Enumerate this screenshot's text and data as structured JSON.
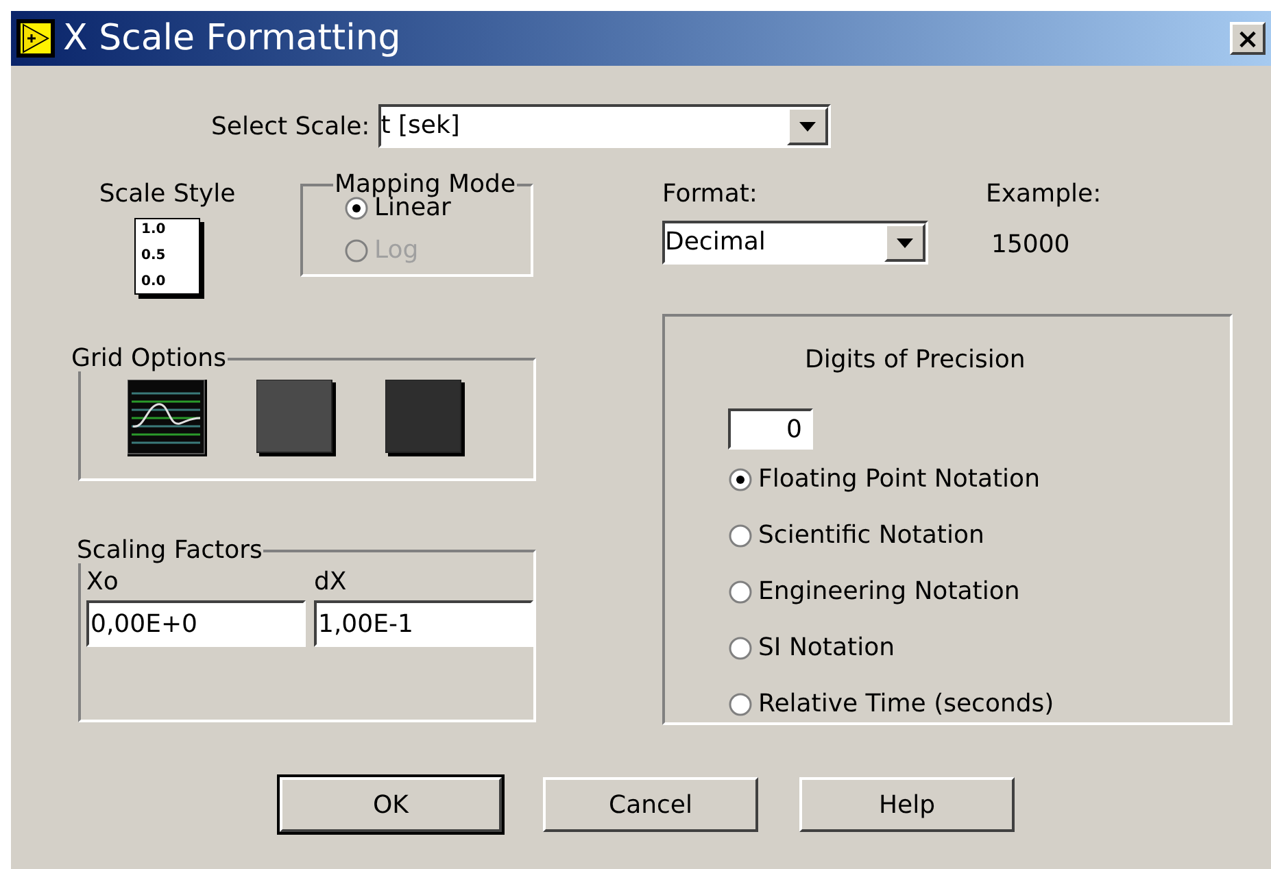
{
  "window": {
    "title": "X Scale Formatting",
    "close": "×"
  },
  "select_scale": {
    "label": "Select Scale:",
    "value": "t [sek]"
  },
  "scale_style": {
    "label": "Scale Style",
    "tick_labels": [
      "1.0",
      "0.5",
      "0.0"
    ]
  },
  "mapping_mode": {
    "title": "Mapping Mode",
    "options": [
      {
        "label": "Linear",
        "selected": true,
        "disabled": false
      },
      {
        "label": "Log",
        "selected": false,
        "disabled": true
      }
    ]
  },
  "grid_options": {
    "title": "Grid Options",
    "items": [
      {
        "kind": "grid"
      },
      {
        "kind": "medium"
      },
      {
        "kind": "dark"
      }
    ]
  },
  "scaling_factors": {
    "title": "Scaling Factors",
    "fields": [
      {
        "label": "Xo",
        "value": "0,00E+0"
      },
      {
        "label": "dX",
        "value": "1,00E-1"
      }
    ]
  },
  "format": {
    "label": "Format:",
    "value": "Decimal"
  },
  "example": {
    "label": "Example:",
    "value": "15000"
  },
  "precision": {
    "title": "Digits of Precision",
    "value": "0",
    "notations": [
      {
        "label": "Floating Point Notation",
        "selected": true
      },
      {
        "label": "Scientific Notation",
        "selected": false
      },
      {
        "label": "Engineering Notation",
        "selected": false
      },
      {
        "label": "SI Notation",
        "selected": false
      },
      {
        "label": "Relative Time (seconds)",
        "selected": false
      }
    ]
  },
  "buttons": [
    {
      "label": "OK",
      "default": true
    },
    {
      "label": "Cancel",
      "default": false
    },
    {
      "label": "Help",
      "default": false
    }
  ]
}
